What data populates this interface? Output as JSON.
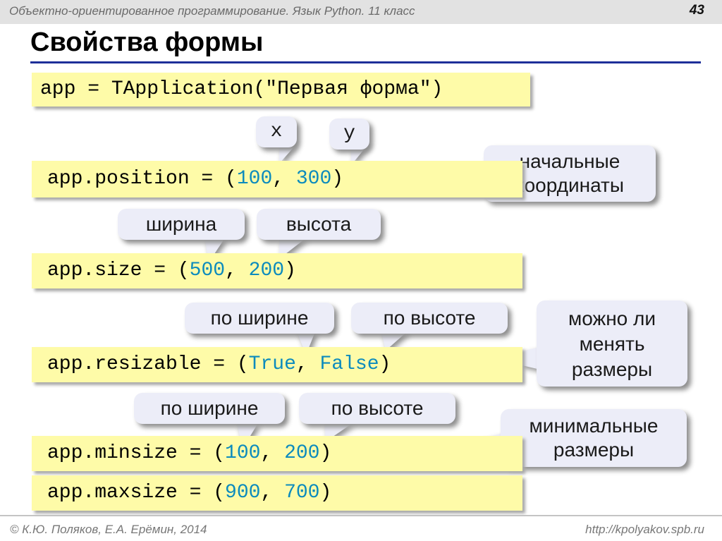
{
  "header": {
    "course": "Объектно-ориентированное программирование. Язык Python. 11 класс",
    "slide_number": "43"
  },
  "title": "Свойства формы",
  "code": {
    "line1": {
      "prefix": "app = TApplication(",
      "arg": "\"Первая форма\"",
      "suffix": ")"
    },
    "position": {
      "prefix": "app.position = (",
      "v1": "100",
      "sep": ", ",
      "v2": "300",
      "suffix": ")"
    },
    "size": {
      "prefix": "app.size = (",
      "v1": "500",
      "sep": ", ",
      "v2": "200",
      "suffix": ")"
    },
    "resizable": {
      "prefix": "app.resizable = (",
      "v1": "True",
      "sep": ", ",
      "v2": "False",
      "suffix": ")"
    },
    "minsize": {
      "prefix": "app.minsize = (",
      "v1": "100",
      "sep": ", ",
      "v2": "200",
      "suffix": ")"
    },
    "maxsize": {
      "prefix": "app.maxsize = (",
      "v1": "900",
      "sep": ", ",
      "v2": "700",
      "suffix": ")"
    }
  },
  "callouts": {
    "x": "x",
    "y": "y",
    "start_coords": [
      "начальные",
      "координаты"
    ],
    "width": "ширина",
    "height": "высота",
    "by_width_1": "по ширине",
    "by_height_1": "по высоте",
    "can_resize": [
      "можно ли",
      "менять",
      "размеры"
    ],
    "by_width_2": "по ширине",
    "by_height_2": "по высоте",
    "min_sizes": [
      "минимальные",
      "размеры"
    ]
  },
  "footer": {
    "authors": "© К.Ю. Поляков, Е.А. Ерёмин, 2014",
    "url": "http://kpolyakov.spb.ru"
  },
  "colors": {
    "code_bg": "#fefba8",
    "number": "#0c8bbd",
    "bubble_bg": "#ecedf8",
    "rule": "#1e2f99"
  }
}
